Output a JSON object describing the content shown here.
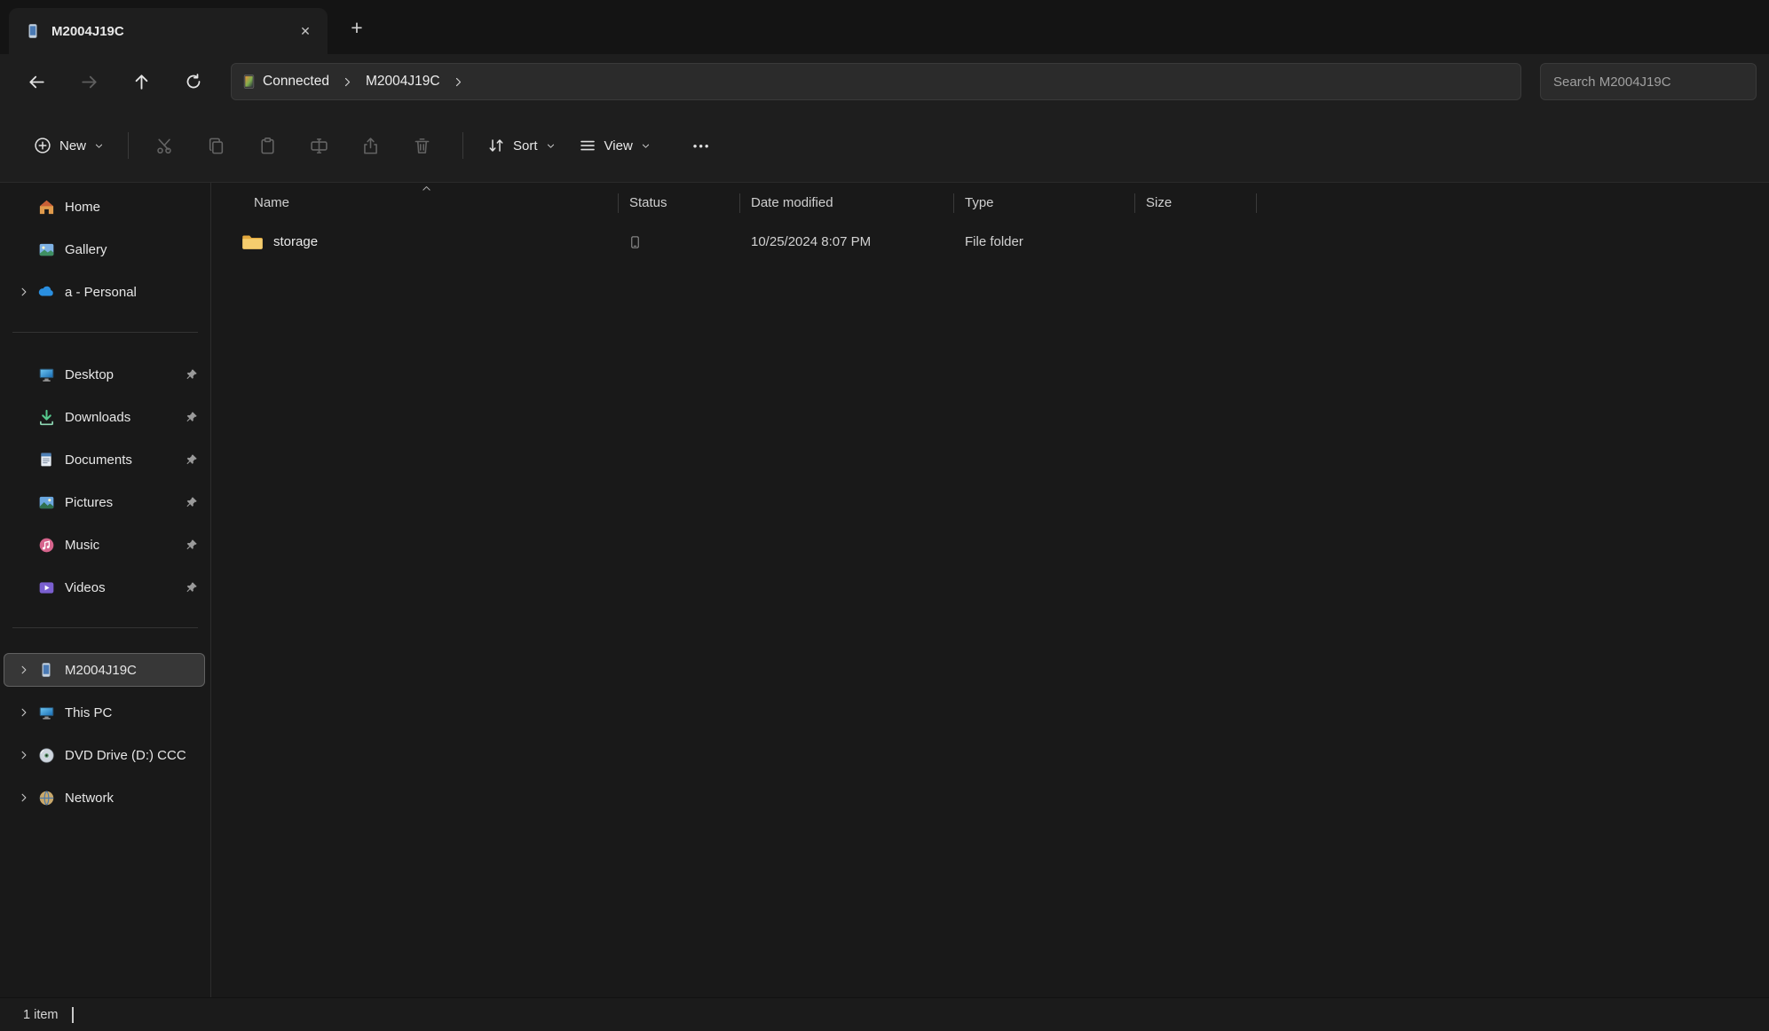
{
  "icons": {
    "close": "✕",
    "plus": "+",
    "more": "•••"
  },
  "tab": {
    "title": "M2004J19C"
  },
  "nav": {
    "breadcrumb": {
      "device": "Connected",
      "folder": "M2004J19C"
    },
    "search_placeholder": "Search M2004J19C"
  },
  "toolbar": {
    "new": "New",
    "sort": "Sort",
    "view": "View"
  },
  "sidebar": {
    "items": [
      {
        "label": "Home"
      },
      {
        "label": "Gallery"
      },
      {
        "label": "a - Personal"
      },
      {
        "label": "Desktop"
      },
      {
        "label": "Downloads"
      },
      {
        "label": "Documents"
      },
      {
        "label": "Pictures"
      },
      {
        "label": "Music"
      },
      {
        "label": "Videos"
      },
      {
        "label": "M2004J19C"
      },
      {
        "label": "This PC"
      },
      {
        "label": "DVD Drive (D:) CCC"
      },
      {
        "label": "Network"
      }
    ]
  },
  "main": {
    "columns": {
      "name": "Name",
      "status": "Status",
      "date_modified": "Date modified",
      "type": "Type",
      "size": "Size"
    },
    "rows": [
      {
        "name": "storage",
        "date_modified": "10/25/2024 8:07 PM",
        "type": "File folder",
        "size": ""
      }
    ]
  },
  "statusbar": {
    "count": "1 item"
  }
}
